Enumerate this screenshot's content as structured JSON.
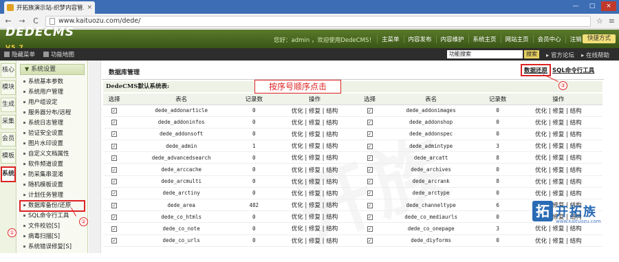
{
  "browser": {
    "tab_title": "开拓族演示站-织梦内容管...",
    "tab_close": "×",
    "url": "www.kaituozu.com/dede/",
    "back": "←",
    "forward": "→",
    "reload": "C",
    "win_min": "—",
    "win_max": "□",
    "win_close": "×"
  },
  "header": {
    "logo": "DEDECMS",
    "version": "V5.7",
    "welcome": "您好：admin ，欢迎使用DedeCMS！",
    "nav": [
      "主菜单",
      "内容发布",
      "内容维护",
      "系统主页",
      "网站主页",
      "会员中心",
      "注销"
    ],
    "quick": "快捷方式"
  },
  "subbar": {
    "hide_menu": "隐藏菜单",
    "feature_map": "功能地图",
    "search_value": "功能搜索",
    "search_btn": "搜索",
    "forum": "官方论坛",
    "help": "在线帮助"
  },
  "vtabs": [
    "核心",
    "模块",
    "生成",
    "采集",
    "会员",
    "模板",
    "系统"
  ],
  "sidebar": {
    "heading": "系统设置",
    "items": [
      "系统基本参数",
      "系统用户管理",
      "用户组设定",
      "服务器分布/远程",
      "系统日志管理",
      "验证安全设置",
      "图片水印设置",
      "自定义文档属性",
      "软件频道设置",
      "防采集串混淆",
      "随机模板设置",
      "计划任务管理",
      "数据库备份/还原",
      "SQL命令行工具",
      "文件校验[S]",
      "病毒扫描[S]",
      "系统错误修复[S]"
    ]
  },
  "main": {
    "title": "数据库管理",
    "restore": "数据还原",
    "sqltool": "SQL命令行工具",
    "defaults": "DedeCMS默认系统表:",
    "annotation": "按序号顺序点击",
    "columns": [
      "选择",
      "表名",
      "记录数",
      "操作",
      "选择",
      "表名",
      "记录数",
      "操作"
    ],
    "action_label": "优化 | 修复 | 结构",
    "checkmark": "✓",
    "rows": [
      {
        "l": "dede_addonarticle",
        "lc": "0",
        "r": "dede_addonimages",
        "rc": "0"
      },
      {
        "l": "dede_addoninfos",
        "lc": "0",
        "r": "dede_addonshop",
        "rc": "0"
      },
      {
        "l": "dede_addonsoft",
        "lc": "0",
        "r": "dede_addonspec",
        "rc": "0"
      },
      {
        "l": "dede_admin",
        "lc": "1",
        "r": "dede_admintype",
        "rc": "3"
      },
      {
        "l": "dede_advancedsearch",
        "lc": "0",
        "r": "dede_arcatt",
        "rc": "8"
      },
      {
        "l": "dede_arccache",
        "lc": "0",
        "r": "dede_archives",
        "rc": "0"
      },
      {
        "l": "dede_arcmulti",
        "lc": "0",
        "r": "dede_arcrank",
        "rc": "8"
      },
      {
        "l": "dede_arctiny",
        "lc": "0",
        "r": "dede_arctype",
        "rc": "0"
      },
      {
        "l": "dede_area",
        "lc": "482",
        "r": "dede_channeltype",
        "rc": "6"
      },
      {
        "l": "dede_co_htmls",
        "lc": "0",
        "r": "dede_co_mediaurls",
        "rc": "0"
      },
      {
        "l": "dede_co_note",
        "lc": "0",
        "r": "dede_co_onepage",
        "rc": "3"
      },
      {
        "l": "dede_co_urls",
        "lc": "0",
        "r": "dede_diyforms",
        "rc": "0"
      }
    ]
  },
  "markers": [
    "①",
    "②",
    "③"
  ],
  "watermark": {
    "brand": "开拓族",
    "icon": "拓",
    "url": "www.kaituozu.com",
    "big": "开族"
  },
  "colors": {
    "header_green": "#3a5517",
    "annotation_red": "#dd2222"
  }
}
